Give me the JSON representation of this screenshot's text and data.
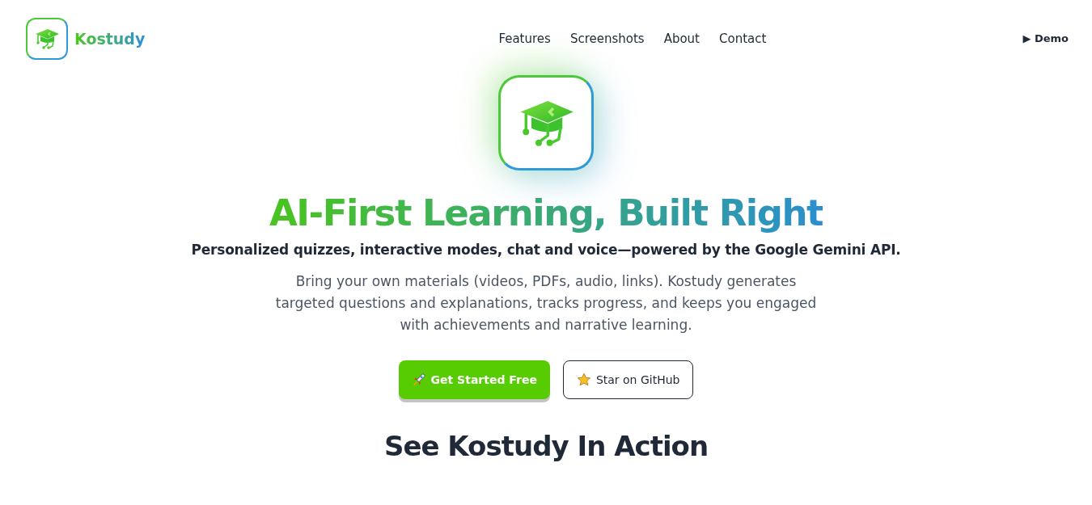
{
  "brand": {
    "name": "Kostudy"
  },
  "nav": [
    {
      "label": "Features"
    },
    {
      "label": "Screenshots"
    },
    {
      "label": "About"
    },
    {
      "label": "Contact"
    }
  ],
  "demo_link": "▶ Demo",
  "hero": {
    "title_start": "AI-First Learning,",
    "title_end": "Built Right",
    "subtitle": "Personalized quizzes, interactive modes, chat and voice—powered by the Google Gemini API.",
    "description": "Bring your own materials (videos, PDFs, audio, links). Kostudy generates targeted questions and explanations, tracks progress, and keeps you engaged with achievements and narrative learning.",
    "buttons": [
      {
        "label": "Get Started Free",
        "kind": "primary"
      },
      {
        "label": "Star on GitHub",
        "kind": "outline"
      }
    ]
  },
  "section_title": "See Kostudy In Action"
}
